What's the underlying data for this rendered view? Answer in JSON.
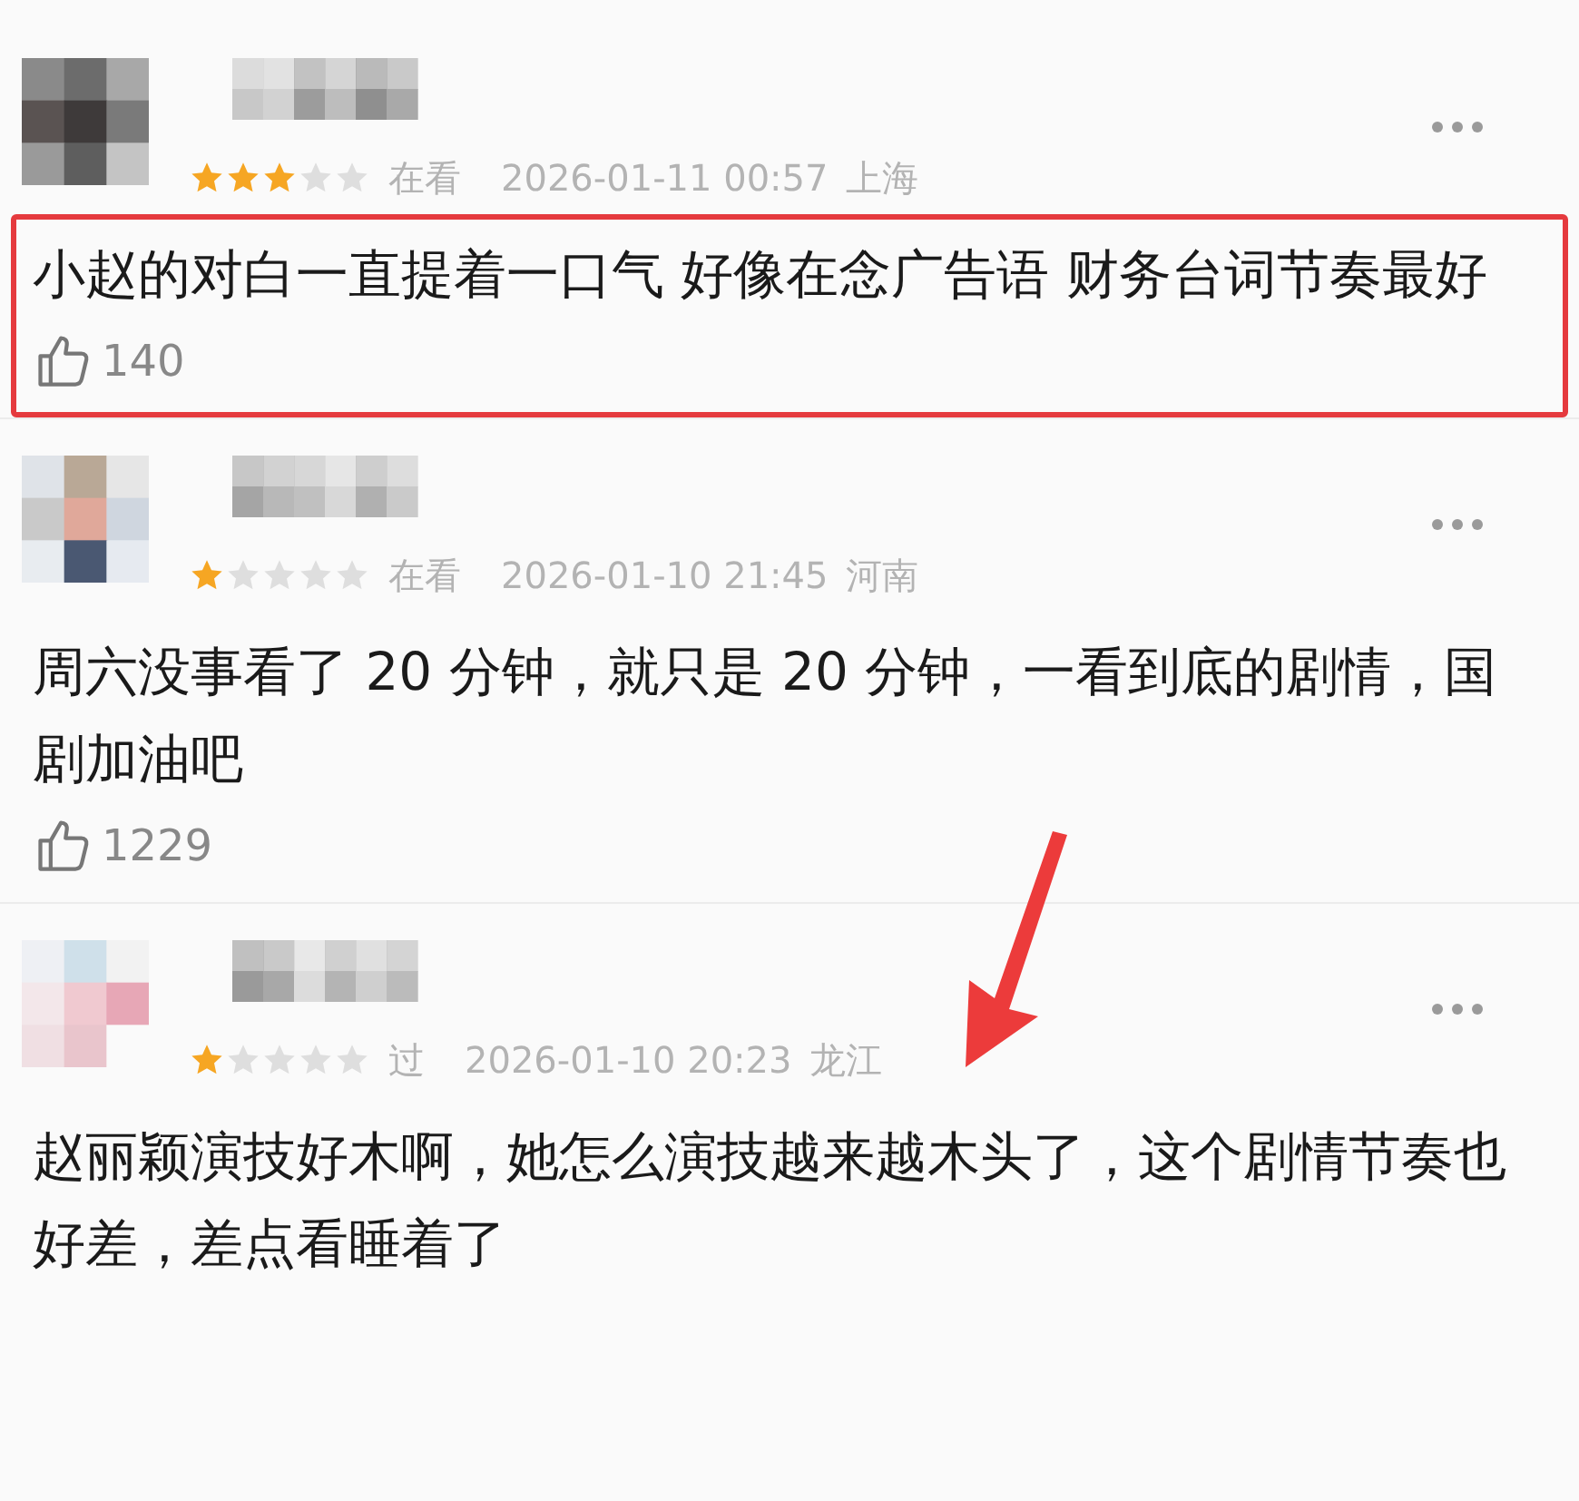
{
  "reviews": [
    {
      "stars": 3,
      "status": "在看",
      "time": "2026-01-11 00:57",
      "location": "上海",
      "text": "小赵的对白一直提着一口气 好像在念广告语 财务台词节奏最好",
      "likes": "140",
      "highlighted": true,
      "pointed": false
    },
    {
      "stars": 1,
      "status": "在看",
      "time": "2026-01-10 21:45",
      "location": "河南",
      "text": "周六没事看了 20 分钟，就只是 20 分钟，一看到底的剧情，国剧加油吧",
      "likes": "1229",
      "highlighted": false,
      "pointed": false
    },
    {
      "stars": 1,
      "status": "过",
      "time": "2026-01-10 20:23",
      "location": "龙江",
      "text": "赵丽颖演技好木啊，她怎么演技越来越木头了，这个剧情节奏也好差，差点看睡着了",
      "highlighted": false,
      "pointed": true
    }
  ]
}
